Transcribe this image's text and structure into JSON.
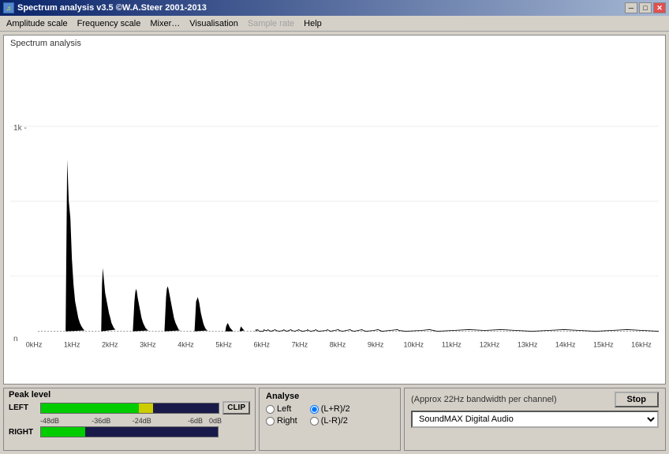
{
  "titlebar": {
    "icon": "♫",
    "title": "Spectrum analysis v3.5  ©W.A.Steer  2001-2013",
    "controls": {
      "minimize": "─",
      "maximize": "□",
      "close": "✕"
    }
  },
  "menubar": {
    "items": [
      {
        "label": "Amplitude scale",
        "disabled": false
      },
      {
        "label": "Frequency scale",
        "disabled": false
      },
      {
        "label": "Mixer…",
        "disabled": false
      },
      {
        "label": "Visualisation",
        "disabled": false
      },
      {
        "label": "Sample rate",
        "disabled": true
      },
      {
        "label": "Help",
        "disabled": false
      }
    ]
  },
  "spectrum": {
    "panel_label": "Spectrum analysis",
    "y_label_1k": "1k",
    "y_label_nl": "n",
    "x_labels": [
      "0kHz",
      "1kHz",
      "2kHz",
      "3kHz",
      "4kHz",
      "5kHz",
      "6kHz",
      "7kHz",
      "8kHz",
      "9kHz",
      "10kHz",
      "11kHz",
      "12kHz",
      "13kHz",
      "14kHz",
      "15kHz",
      "16kHz"
    ]
  },
  "peak_level": {
    "title": "Peak level",
    "left_label": "LEFT",
    "right_label": "RIGHT",
    "markers": [
      "-48dB",
      "-36dB",
      "-24dB",
      "-6dB",
      "0dB"
    ],
    "clip_label": "CLIP"
  },
  "analyse": {
    "title": "Analyse",
    "options": [
      {
        "id": "left",
        "label": "Left",
        "checked": false
      },
      {
        "id": "right",
        "label": "Right",
        "checked": false
      },
      {
        "id": "lpr2",
        "label": "(L+R)/2",
        "checked": true
      },
      {
        "id": "lmr2",
        "label": "(L-R)/2",
        "checked": false
      }
    ]
  },
  "device": {
    "bandwidth_label": "(Approx 22Hz bandwidth per channel)",
    "stop_label": "Stop",
    "device_name": "SoundMAX Digital Audio"
  }
}
